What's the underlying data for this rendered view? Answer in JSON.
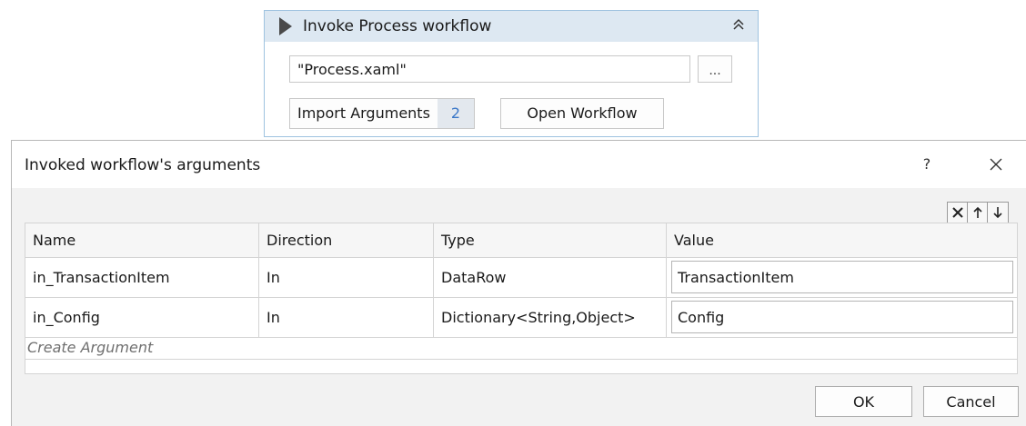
{
  "activity": {
    "title": "Invoke Process workflow",
    "file_path": "\"Process.xaml\"",
    "browse_label": "...",
    "import_arguments_label": "Import Arguments",
    "argument_count": "2",
    "open_workflow_label": "Open Workflow",
    "icons": {
      "play": "play-triangle-icon",
      "collapse": "double-chevron-up-icon"
    }
  },
  "dialog": {
    "title": "Invoked workflow's arguments",
    "help_label": "?",
    "toolbar": {
      "delete_icon": "delete-x-icon",
      "up_icon": "arrow-up-icon",
      "down_icon": "arrow-down-icon"
    },
    "columns": [
      "Name",
      "Direction",
      "Type",
      "Value"
    ],
    "rows": [
      {
        "name": "in_TransactionItem",
        "direction": "In",
        "type": "DataRow",
        "value": "TransactionItem"
      },
      {
        "name": "in_Config",
        "direction": "In",
        "type": "Dictionary<String,Object>",
        "value": "Config"
      }
    ],
    "create_argument_label": "Create Argument",
    "ok_label": "OK",
    "cancel_label": "Cancel"
  }
}
